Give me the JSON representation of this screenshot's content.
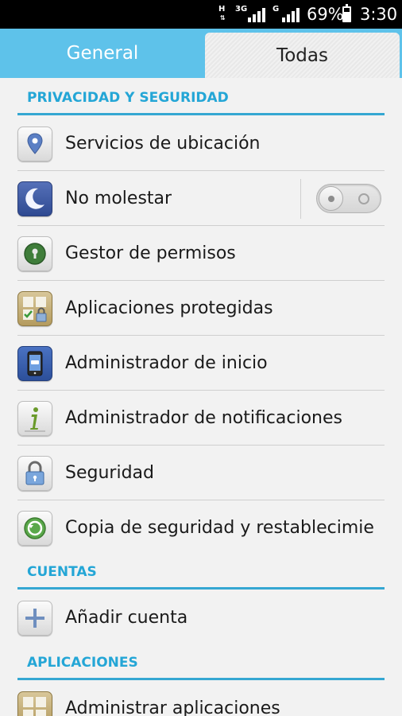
{
  "status_bar": {
    "network_h": "H",
    "network_3g": "3G",
    "network_g": "G",
    "battery_percent": "69%",
    "battery_level": 0.69,
    "time": "3:30"
  },
  "tabs": [
    {
      "label": "General",
      "selected": false
    },
    {
      "label": "Todas",
      "selected": true
    }
  ],
  "colors": {
    "accent": "#24a6d6",
    "tab_bar": "#5ec2ea"
  },
  "sections": {
    "privacy": {
      "title": "PRIVACIDAD Y SEGURIDAD",
      "items": [
        {
          "label": "Servicios de ubicación",
          "icon": "location-pin-icon"
        },
        {
          "label": "No molestar",
          "icon": "moon-icon",
          "toggle": false
        },
        {
          "label": "Gestor de permisos",
          "icon": "keyhole-icon"
        },
        {
          "label": "Aplicaciones protegidas",
          "icon": "protected-apps-icon"
        },
        {
          "label": "Administrador de inicio",
          "icon": "startup-manager-icon"
        },
        {
          "label": "Administrador de notificaciones",
          "icon": "info-icon"
        },
        {
          "label": "Seguridad",
          "icon": "padlock-icon"
        },
        {
          "label": "Copia de seguridad y restablecimie",
          "icon": "backup-restore-icon"
        }
      ]
    },
    "accounts": {
      "title": "CUENTAS",
      "items": [
        {
          "label": "Añadir cuenta",
          "icon": "plus-icon"
        }
      ]
    },
    "apps": {
      "title": "APLICACIONES",
      "items": [
        {
          "label": "Administrar aplicaciones",
          "icon": "manage-apps-icon"
        }
      ]
    }
  }
}
